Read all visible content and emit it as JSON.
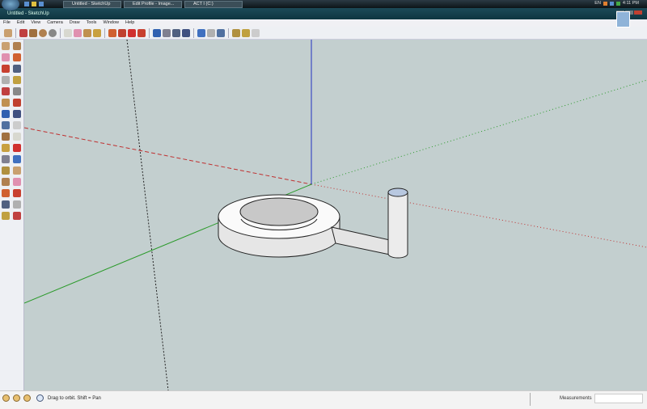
{
  "taskbar": {
    "tasks": [
      "Untitled - SketchUp",
      "Edit Profile - Image...",
      "ACT I (C:)"
    ],
    "lang": "EN",
    "clock": "4:11 PM"
  },
  "window": {
    "title": "Untitled - SketchUp"
  },
  "menu": [
    "File",
    "Edit",
    "View",
    "Camera",
    "Draw",
    "Tools",
    "Window",
    "Help"
  ],
  "toolbar_icons": [
    "select",
    "line",
    "rectangle",
    "circle",
    "arc",
    "make-component",
    "eraser",
    "tape-measure",
    "paint-bucket",
    "push-pull",
    "move",
    "rotate",
    "follow-me",
    "orbit",
    "pan",
    "zoom",
    "zoom-extents",
    "get-models",
    "share-model",
    "component-3d",
    "get-photo-texture",
    "share-component",
    "extension"
  ],
  "left_icons": [
    "select",
    "make-component",
    "paint-bucket",
    "eraser",
    "rectangle",
    "line",
    "circle",
    "arc",
    "polygon",
    "freehand",
    "move",
    "push-pull",
    "rotate",
    "follow-me",
    "scale",
    "offset",
    "tape-measure",
    "dimension",
    "protractor",
    "text",
    "axes",
    "3d-text",
    "orbit",
    "pan",
    "zoom",
    "zoom-window",
    "previous",
    "zoom-extents",
    "position-camera",
    "look-around",
    "walk",
    "section-plane"
  ],
  "colors": {
    "viewport": "#c3cfcf",
    "red_axis": "#c03030",
    "green_axis": "#2a9a2a",
    "blue_axis": "#2030c0"
  },
  "status": {
    "hint": "Drag to orbit.  Shift = Pan",
    "measurements_label": "Measurements",
    "measurements_value": ""
  }
}
